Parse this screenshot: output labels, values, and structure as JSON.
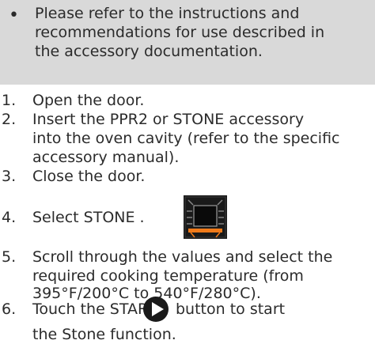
{
  "note": {
    "bullet": "•",
    "lines": [
      "Please refer to the instructions and",
      "recommendations for use described in",
      "the accessory documentation."
    ]
  },
  "steps": [
    {
      "num": "1.",
      "lines": [
        "Open the door."
      ]
    },
    {
      "num": "2.",
      "lines": [
        "Insert the PPR2 or STONE accessory",
        "into the oven cavity (refer to the specific",
        "accessory manual)."
      ]
    },
    {
      "num": "3.",
      "lines": [
        "Close the door."
      ]
    },
    {
      "num": "4.",
      "lines": [
        "Select STONE ."
      ]
    },
    {
      "num": "5.",
      "lines": [
        "Scroll through the values and select the",
        "required cooking temperature (from",
        "395°F/200°C to 540°F/280°C)."
      ]
    },
    {
      "num": "6.",
      "text_before": "Touch the START",
      "text_after": "button to start",
      "line2": "the Stone function."
    }
  ],
  "icons": {
    "stone": "stone-function-icon",
    "play": "start-play-icon",
    "accent": "#f07a1a",
    "icon_bg": "#1a1a1a"
  }
}
